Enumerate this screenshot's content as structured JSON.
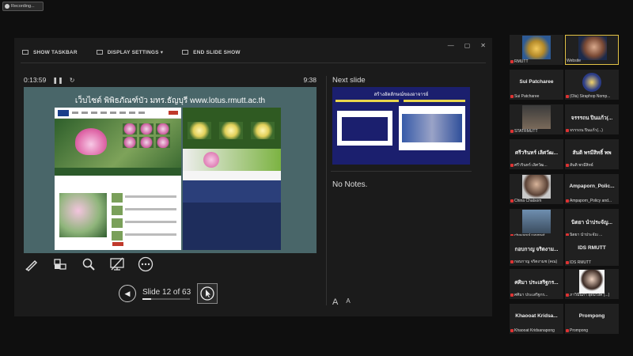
{
  "recording": {
    "label": "Recording..."
  },
  "toolbar": {
    "show_taskbar": "SHOW TASKBAR",
    "display_settings": "DISPLAY SETTINGS ▾",
    "end_slide_show": "END SLIDE SHOW"
  },
  "window": {
    "minimize": "—",
    "restore": "▢",
    "close": "✕"
  },
  "timer": {
    "elapsed": "0:13:59",
    "pause": "❚❚",
    "reset": "↻",
    "clock": "9:38"
  },
  "current_slide": {
    "caption": "เว็บไซต์ พิพิธภัณฑ์บัว มทร.ธัญบุรี www.lotus.rmutt.ac.th"
  },
  "navigation": {
    "prev": "◀",
    "slide_text": "Slide 12 of 63",
    "current": 12,
    "total": 63
  },
  "next_slide": {
    "label": "Next slide",
    "thumb_title": "สร้างอัตลักษณ์ของอาจารย์"
  },
  "notes": {
    "text": "No Notes."
  },
  "font_controls": {
    "larger": "A",
    "smaller": "A"
  },
  "participants": [
    {
      "label": "RMUTT",
      "name": ""
    },
    {
      "label": "Website",
      "name": ""
    },
    {
      "label": "Sui Patcharee",
      "name": "Sui Patcharee"
    },
    {
      "label": "(Ola) Siraphop Nomp...",
      "name": ""
    },
    {
      "label": "STATRMUTT",
      "name": ""
    },
    {
      "label": "จรรรถน ปินแก้ว(...)",
      "name": "จรรรถน ปินแก้ว(..."
    },
    {
      "label": "ศรีวรินทร์ เลิศวัฒ...",
      "name": "ศรีวรินทร์ เลิศวัฒ..."
    },
    {
      "label": "สันติ พรมีสิทธ์",
      "name": "สันติ พรมีสิทธิ์ พพ"
    },
    {
      "label": "China Chatsom",
      "name": ""
    },
    {
      "label": "Ampaporn_Policy and...",
      "name": "Ampaporn_Polic..."
    },
    {
      "label": "chayapol rangpet",
      "name": ""
    },
    {
      "label": "นิตยา นำประจัญ ...",
      "name": "นิตยา นำประจัญ..."
    },
    {
      "label": "กอบกาญ จริตงามช (คณ)",
      "name": "กอบกาญ จริตงาม..."
    },
    {
      "label": "IDS RMUTT",
      "name": "IDS RMUTT"
    },
    {
      "label": "ศศิมา ประเสริฐกร...",
      "name": "ศศิมา ประเสริฐกร..."
    },
    {
      "label": "ภาวินีนภา อุดมวงค์ (...)",
      "name": ""
    },
    {
      "label": "Khaooat Kridsanapong",
      "name": "Khaooat Kridsa..."
    },
    {
      "label": "Prompong",
      "name": "Prompong"
    }
  ]
}
